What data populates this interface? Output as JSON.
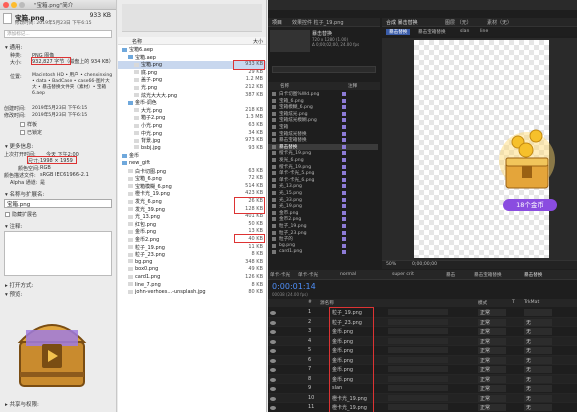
{
  "info": {
    "title": "\"宝箱.png\"简介",
    "filename": "宝箱.png",
    "size_header": "933 KB",
    "modified_header": "修改时间: 2019年5月23日 下午6:15",
    "tags_label": "添加标记...",
    "general_label": "通用:",
    "kind_label": "种类:",
    "kind_value": "PNG 图像",
    "size_label": "大小:",
    "size_value": "932,827 字节（磁盘上的 934 KB）",
    "where_label": "位置:",
    "where_value": "Macintosh HD • 用户 • chenxinxing • data • BadCase • case66-图片大大 • 暴击替换文件夹（素材）• 宝箱6.aep",
    "created_label": "创建时间:",
    "created_value": "2019年5月23日 下午6:15",
    "modified_label": "修改时间:",
    "modified_value": "2019年5月23日 下午6:15",
    "stationery_label": "样板",
    "locked_label": "已锁定",
    "more_label": "更多信息:",
    "lastopen_label": "上次打开时间:",
    "lastopen_value": "今天 下午2:00",
    "dim_label": "尺寸:",
    "dim_value": "1998 × 1959",
    "colorspace_label": "颜色空间:",
    "colorspace_value": "RGB",
    "profile_label": "颜色描述文件:",
    "profile_value": "sRGB IEC61966-2.1",
    "alpha_label": "Alpha 通道:",
    "alpha_value": "是",
    "nameext_label": "名称与扩展名:",
    "name_value": "宝箱.png",
    "hide_ext_label": "隐藏扩展名",
    "comments_label": "注释:",
    "openwith_label": "打开方式:",
    "preview_label": "预览:",
    "share_label": "共享与权限:"
  },
  "finder": {
    "col_name": "名称",
    "col_size": "大小",
    "rows": [
      {
        "name": "宝箱6.aep",
        "size": ""
      },
      {
        "name": "宝箱.aep",
        "size": ""
      },
      {
        "name": "宝箱.png",
        "size": "933 KB"
      },
      {
        "name": "底.png",
        "size": "29 KB"
      },
      {
        "name": "盖子.png",
        "size": "1.2 MB"
      },
      {
        "name": "光.png",
        "size": "212 KB"
      },
      {
        "name": "炫光大大大.png",
        "size": "387 KB"
      },
      {
        "name": "金币-调色",
        "size": ""
      },
      {
        "name": "大光.png",
        "size": "218 KB"
      },
      {
        "name": "箱子2.png",
        "size": "1.3 MB"
      },
      {
        "name": "小光.png",
        "size": "63 KB"
      },
      {
        "name": "中光.png",
        "size": "34 KB"
      },
      {
        "name": "背景.jpg",
        "size": "973 KB"
      },
      {
        "name": "bsbj.jpg",
        "size": "93 KB"
      },
      {
        "name": "金币",
        "size": ""
      },
      {
        "name": "new_gift",
        "size": ""
      },
      {
        "name": "白卡切图.png",
        "size": "63 KB"
      },
      {
        "name": "宝箱_6.png",
        "size": "72 KB"
      },
      {
        "name": "宝箱模糊_6.png",
        "size": "514 KB"
      },
      {
        "name": "橙卡光_19.png",
        "size": "423 KB"
      },
      {
        "name": "发光_6.png",
        "size": "26 KB"
      },
      {
        "name": "发光_39.png",
        "size": "128 KB"
      },
      {
        "name": "光_13.png",
        "size": "401 KB"
      },
      {
        "name": "红包.png",
        "size": "50 KB"
      },
      {
        "name": "金币.png",
        "size": "13 KB"
      },
      {
        "name": "金币2.png",
        "size": "40 KB"
      },
      {
        "name": "粒子_19.png",
        "size": "11 KB"
      },
      {
        "name": "粒子_23.png",
        "size": "8 KB"
      },
      {
        "name": "bg.png",
        "size": "348 KB"
      },
      {
        "name": "box0.png",
        "size": "49 KB"
      },
      {
        "name": "card1.png",
        "size": "126 KB"
      },
      {
        "name": "line_7.png",
        "size": "8 KB"
      },
      {
        "name": "john-verhoes...-unsplash.jpg",
        "size": "80 KB"
      }
    ]
  },
  "ae": {
    "project_tab": "项目",
    "effects_tab": "效果控件 粒子_19.png",
    "comp_header": "合成 暴击替换",
    "layer_header": "图层 （无）",
    "material_header": "素材（无）",
    "comp_tabs": [
      "暴击替换",
      "暴击宝箱替换",
      "slan",
      "line"
    ],
    "project_name": "暴击替换",
    "project_info": "720 x 1280 (1.00)\nΔ 0;00;02;00, 24.00 fps",
    "proj_col_name": "名称",
    "proj_col_label": "注释",
    "proj_items": [
      "白卡切图%Wd.png",
      "宝箱_6.png",
      "宝箱模糊_6.png",
      "宝箱炫光.png",
      "宝箱炫光模糊.png",
      "宝箱",
      "宝箱炫光替换",
      "暴击宝箱替换",
      "暴击替换",
      "橙卡光_19.png",
      "发光_6.png",
      "橙卡光_19.png",
      "单卡-卡光_5.png",
      "单卡-卡光_6.png",
      "光_13.png",
      "光_15.png",
      "光_33.png",
      "光_19.png",
      "金币.png",
      "金币2.png",
      "粒子_19.png",
      "粒子_23.png",
      "粒子的",
      "bg.png",
      "card1.png"
    ],
    "coin_text": "18个金币",
    "zoom": "50%",
    "timecode_small": "0;00;00;00",
    "tl_tabs": [
      "单卡-卡光",
      "单卡-卡光",
      "normal",
      "super crit",
      "暴击",
      "暴击宝箱替换",
      "暴击替换"
    ],
    "timecode": "0:00:01:14",
    "fps": "00038 (24.00 fps)",
    "tl_col_num": "#",
    "tl_col_name": "源名称",
    "tl_col_mode": "模式",
    "tl_col_t": "T",
    "tl_col_trk": "TrkMat",
    "layers": [
      {
        "num": "1",
        "name": "粒子_19.png",
        "mode": "正常",
        "trk": ""
      },
      {
        "num": "2",
        "name": "粒子_23.png",
        "mode": "正常",
        "trk": "无"
      },
      {
        "num": "3",
        "name": "金币.png",
        "mode": "正常",
        "trk": "无"
      },
      {
        "num": "4",
        "name": "金币.png",
        "mode": "正常",
        "trk": "无"
      },
      {
        "num": "5",
        "name": "金币.png",
        "mode": "正常",
        "trk": "无"
      },
      {
        "num": "6",
        "name": "金币.png",
        "mode": "正常",
        "trk": "无"
      },
      {
        "num": "7",
        "name": "金币.png",
        "mode": "正常",
        "trk": "无"
      },
      {
        "num": "8",
        "name": "金币.png",
        "mode": "正常",
        "trk": "无"
      },
      {
        "num": "9",
        "name": "slan",
        "mode": "正常",
        "trk": "无"
      },
      {
        "num": "10",
        "name": "橙卡光_19.png",
        "mode": "正常",
        "trk": "无"
      },
      {
        "num": "11",
        "name": "橙卡光_19.png",
        "mode": "正常",
        "trk": "无"
      }
    ]
  }
}
